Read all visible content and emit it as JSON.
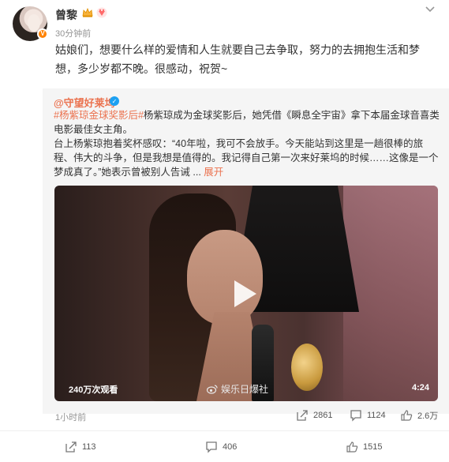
{
  "post": {
    "author": "曾黎",
    "timestamp": "30分钟前",
    "text": "姑娘们，想要什么样的爱情和人生就要自己去争取，努力的去拥抱生活和梦想，多少岁都不晚。很感动，祝贺~",
    "repost": {
      "author": "@守望好莱坞",
      "hashtag": "#杨紫琼金球奖影后#",
      "text_after_hashtag": "杨紫琼成为金球奖影后，她凭借《瞬息全宇宙》拿下本届金球音喜类电影最佳女主角。",
      "text_paragraph2": "台上杨紫琼抱着奖杯感叹：“40年啦，我可不会放手。今天能站到这里是一趟很棒的旅程、伟大的斗争，但是我想是值得的。我记得自己第一次来好莱坞的时候……这像是一个梦成真了。”她表示曾被别人告诫 ...",
      "expand_label": "展开",
      "video": {
        "views": "240万次观看",
        "watermark": "娱乐日爆社",
        "duration": "4:24"
      },
      "time": "1小时前",
      "actions": {
        "share": "2861",
        "comment": "1124",
        "like": "2.6万"
      }
    },
    "actions": {
      "share": "113",
      "comment": "406",
      "like": "1515"
    }
  },
  "colors": {
    "accent": "#eb7350",
    "secondary_text": "#939393",
    "badge": "#ff8200",
    "verified": "#1da1f2"
  }
}
